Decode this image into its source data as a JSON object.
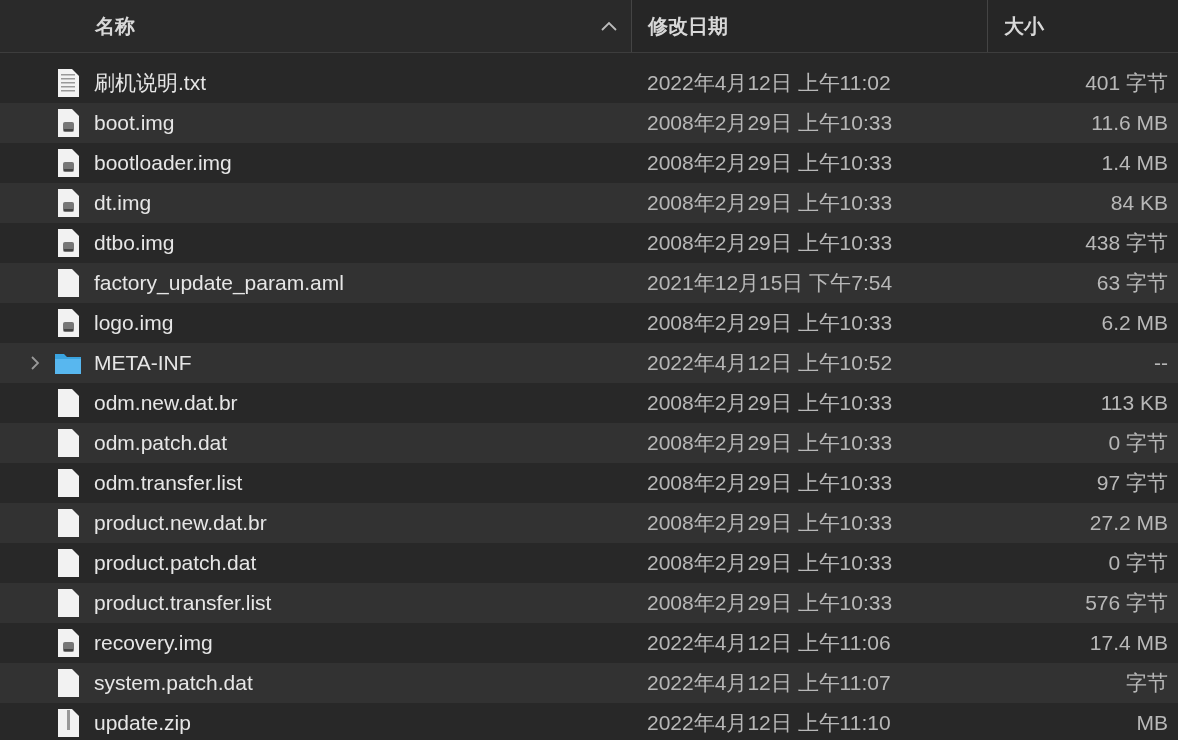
{
  "columns": [
    {
      "label": "名称",
      "sorted": true
    },
    {
      "label": "修改日期",
      "sorted": false
    },
    {
      "label": "大小",
      "sorted": false
    }
  ],
  "files": [
    {
      "name": "刷机说明.txt",
      "kind": "text",
      "date": "2022年4月12日 上午11:02",
      "size": "401 字节"
    },
    {
      "name": "boot.img",
      "kind": "disk",
      "date": "2008年2月29日 上午10:33",
      "size": "11.6 MB"
    },
    {
      "name": "bootloader.img",
      "kind": "disk",
      "date": "2008年2月29日 上午10:33",
      "size": "1.4 MB"
    },
    {
      "name": "dt.img",
      "kind": "disk",
      "date": "2008年2月29日 上午10:33",
      "size": "84 KB"
    },
    {
      "name": "dtbo.img",
      "kind": "disk",
      "date": "2008年2月29日 上午10:33",
      "size": "438 字节"
    },
    {
      "name": "factory_update_param.aml",
      "kind": "blank",
      "date": "2021年12月15日 下午7:54",
      "size": "63 字节"
    },
    {
      "name": "logo.img",
      "kind": "disk",
      "date": "2008年2月29日 上午10:33",
      "size": "6.2 MB"
    },
    {
      "name": "META-INF",
      "kind": "folder",
      "expanded": false,
      "date": "2022年4月12日 上午10:52",
      "size": "--"
    },
    {
      "name": "odm.new.dat.br",
      "kind": "blank",
      "date": "2008年2月29日 上午10:33",
      "size": "113 KB"
    },
    {
      "name": "odm.patch.dat",
      "kind": "blank",
      "date": "2008年2月29日 上午10:33",
      "size": "0 字节"
    },
    {
      "name": "odm.transfer.list",
      "kind": "blank",
      "date": "2008年2月29日 上午10:33",
      "size": "97 字节"
    },
    {
      "name": "product.new.dat.br",
      "kind": "blank",
      "date": "2008年2月29日 上午10:33",
      "size": "27.2 MB"
    },
    {
      "name": "product.patch.dat",
      "kind": "blank",
      "date": "2008年2月29日 上午10:33",
      "size": "0 字节"
    },
    {
      "name": "product.transfer.list",
      "kind": "blank",
      "date": "2008年2月29日 上午10:33",
      "size": "576 字节"
    },
    {
      "name": "recovery.img",
      "kind": "disk",
      "date": "2022年4月12日 上午11:06",
      "size": "17.4 MB"
    },
    {
      "name": "system.patch.dat",
      "kind": "blank",
      "date": "2022年4月12日 上午11:07",
      "size": "字节"
    },
    {
      "name": "update.zip",
      "kind": "zip",
      "date": "2022年4月12日 上午11:10",
      "size": "MB"
    }
  ]
}
